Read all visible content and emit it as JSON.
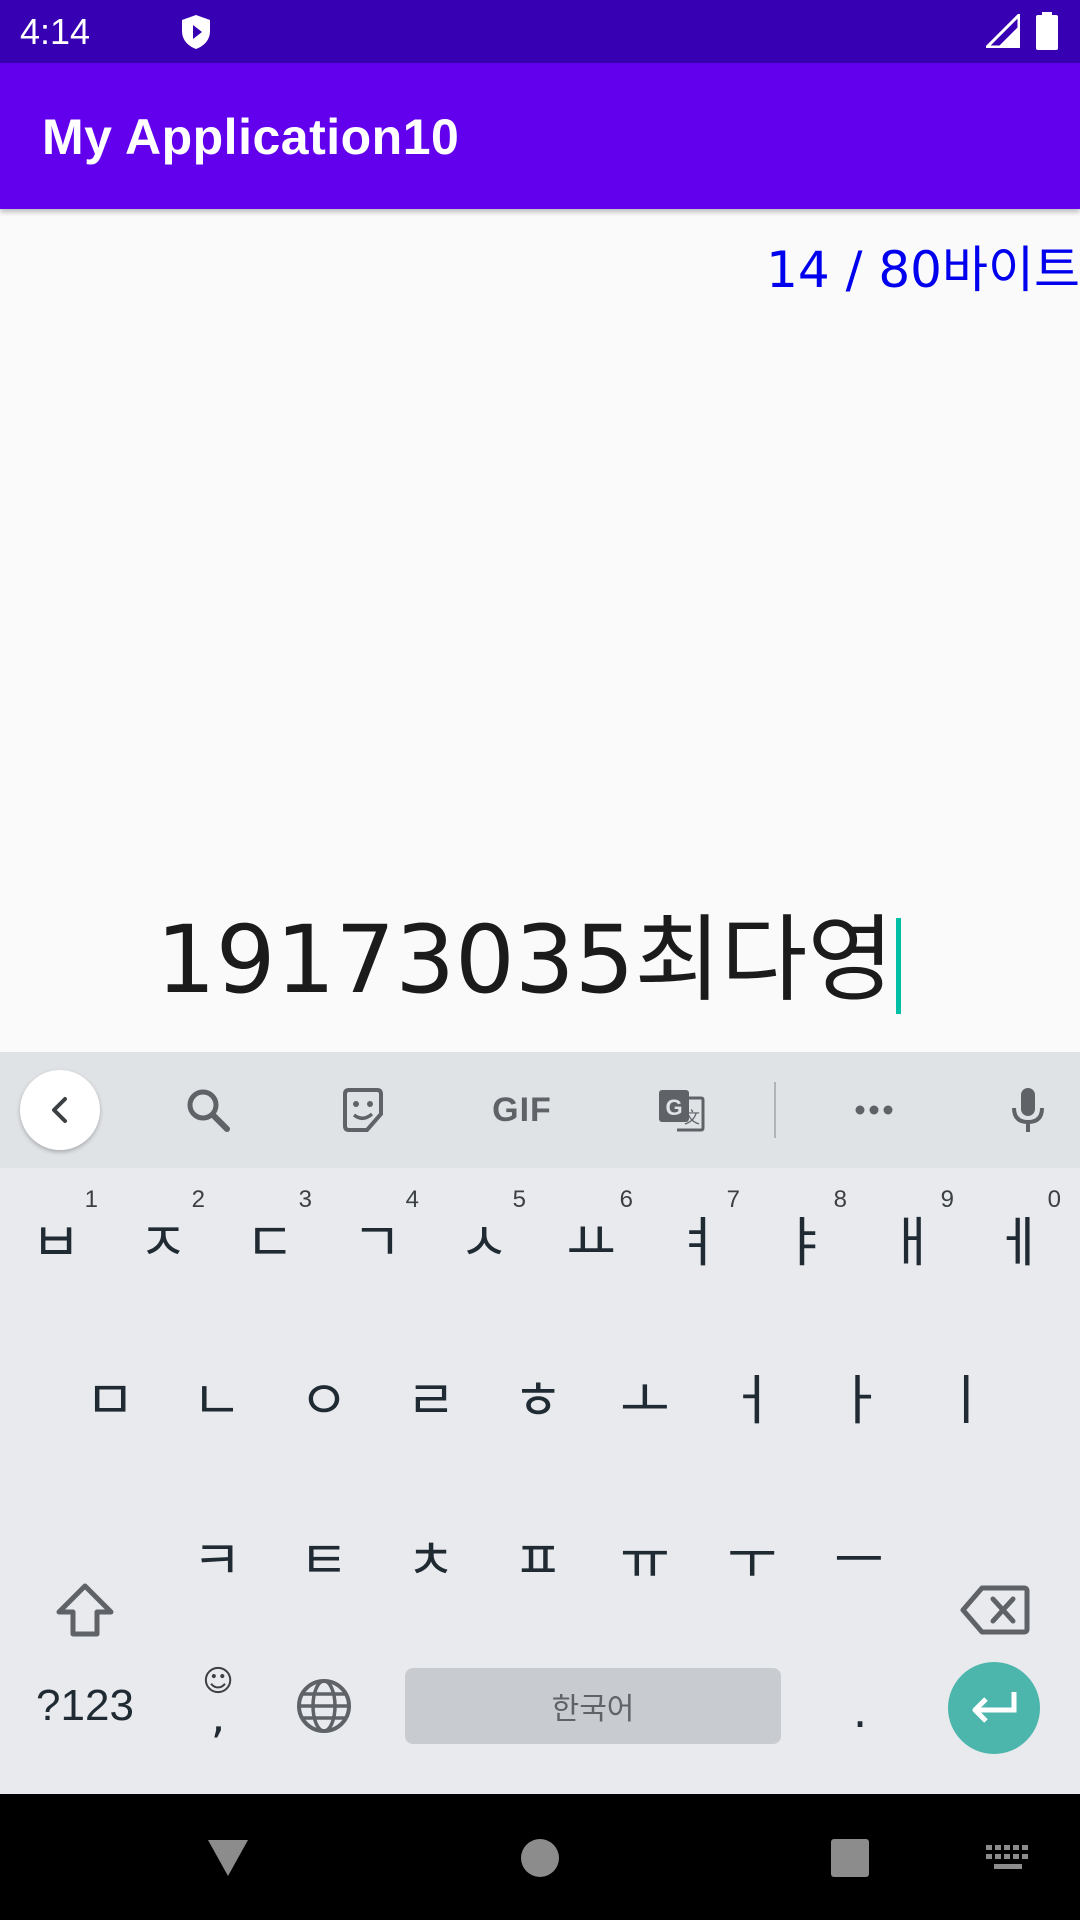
{
  "status_bar": {
    "time": "4:14"
  },
  "app_bar": {
    "title": "My Application10"
  },
  "counter": {
    "text": "14 / 80바이트"
  },
  "input": {
    "value": "19173035최다영"
  },
  "keyboard": {
    "toolbar": [
      "back-icon",
      "search-icon",
      "sticker-icon",
      "GIF",
      "translate-icon",
      "more-icon",
      "mic-icon"
    ],
    "gif_label": "GIF",
    "row1": [
      {
        "key": "ㅂ",
        "hint": "1"
      },
      {
        "key": "ㅈ",
        "hint": "2"
      },
      {
        "key": "ㄷ",
        "hint": "3"
      },
      {
        "key": "ㄱ",
        "hint": "4"
      },
      {
        "key": "ㅅ",
        "hint": "5"
      },
      {
        "key": "ㅛ",
        "hint": "6"
      },
      {
        "key": "ㅕ",
        "hint": "7"
      },
      {
        "key": "ㅑ",
        "hint": "8"
      },
      {
        "key": "ㅐ",
        "hint": "9"
      },
      {
        "key": "ㅔ",
        "hint": "0"
      }
    ],
    "row2": [
      "ㅁ",
      "ㄴ",
      "ㅇ",
      "ㄹ",
      "ㅎ",
      "ㅗ",
      "ㅓ",
      "ㅏ",
      "ㅣ"
    ],
    "row3": [
      "ㅋ",
      "ㅌ",
      "ㅊ",
      "ㅍ",
      "ㅠ",
      "ㅜ",
      "ㅡ"
    ],
    "symbols_label": "?123",
    "comma_label": ",",
    "emoji_hint": "☺",
    "space_label": "한국어",
    "period_label": "."
  },
  "colors": {
    "status_bar": "#3700b3",
    "app_bar": "#6200ee",
    "counter": "#0000ee",
    "cursor": "#00bfa5",
    "enter": "#4db6ac"
  }
}
